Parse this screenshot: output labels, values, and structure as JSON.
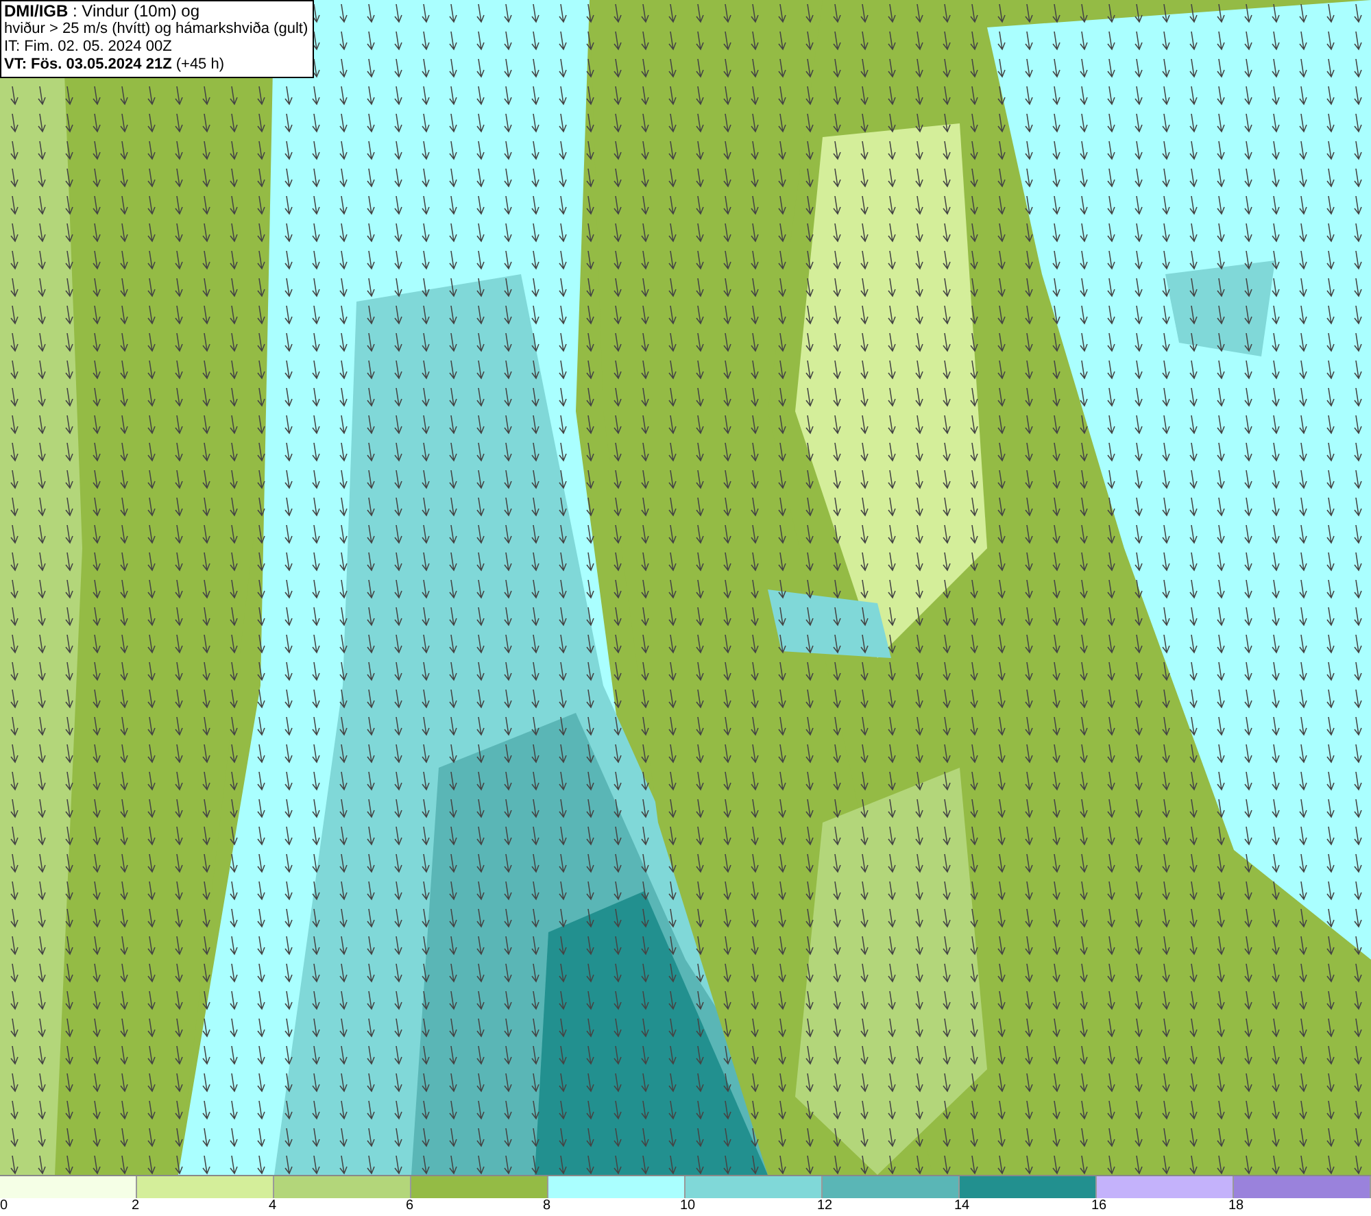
{
  "header": {
    "lines": [
      "**DMI/IGB** : Vindur (10m) og",
      "hviður > 25 m/s (hvítt) og hámarkshviða (gult)",
      "IT: Fim. 02. 05. 2024 00Z",
      "**VT: Fös. 03.05.2024 21Z** (+45 h)"
    ]
  },
  "legend": {
    "bins": [
      {
        "color": "#f5ffe6",
        "label": "0"
      },
      {
        "color": "#d4ee9a",
        "label": "2"
      },
      {
        "color": "#b3d67a",
        "label": "4"
      },
      {
        "color": "#94bb45",
        "label": "6"
      },
      {
        "color": "#aaffff",
        "label": "8"
      },
      {
        "color": "#80d8d8",
        "label": "10"
      },
      {
        "color": "#5ab6b6",
        "label": "12"
      },
      {
        "color": "#22908f",
        "label": "14"
      },
      {
        "color": "#c4b2fb",
        "label": "16"
      },
      {
        "color": "#9a82dc",
        "label": "18"
      }
    ]
  }
}
